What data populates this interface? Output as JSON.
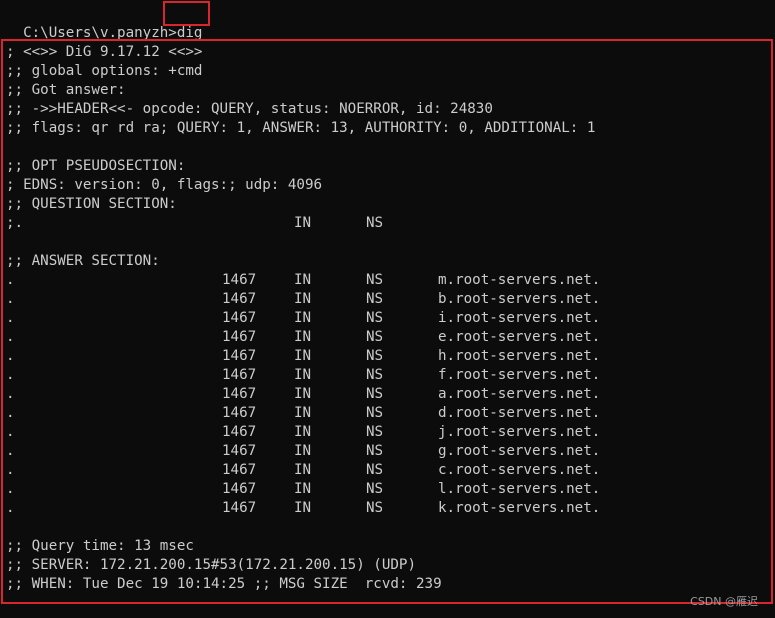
{
  "prompt": {
    "path": "C:\\Users\\v.panyzh>",
    "command": "dig"
  },
  "header_lines": [
    "; <<>> DiG 9.17.12 <<>>",
    ";; global options: +cmd",
    ";; Got answer:",
    ";; ->>HEADER<<- opcode: QUERY, status: NOERROR, id: 24830",
    ";; flags: qr rd ra; QUERY: 1, ANSWER: 13, AUTHORITY: 0, ADDITIONAL: 1"
  ],
  "opt_section": {
    "title": ";; OPT PSEUDOSECTION:",
    "edns": "; EDNS: version: 0, flags:; udp: 4096"
  },
  "question_section": {
    "title": ";; QUESTION SECTION:",
    "row": {
      "name": ";.",
      "class": "IN",
      "type": "NS"
    }
  },
  "answer_section": {
    "title": ";; ANSWER SECTION:",
    "rows": [
      {
        "name": ".",
        "ttl": "1467",
        "class": "IN",
        "type": "NS",
        "value": "m.root-servers.net."
      },
      {
        "name": ".",
        "ttl": "1467",
        "class": "IN",
        "type": "NS",
        "value": "b.root-servers.net."
      },
      {
        "name": ".",
        "ttl": "1467",
        "class": "IN",
        "type": "NS",
        "value": "i.root-servers.net."
      },
      {
        "name": ".",
        "ttl": "1467",
        "class": "IN",
        "type": "NS",
        "value": "e.root-servers.net."
      },
      {
        "name": ".",
        "ttl": "1467",
        "class": "IN",
        "type": "NS",
        "value": "h.root-servers.net."
      },
      {
        "name": ".",
        "ttl": "1467",
        "class": "IN",
        "type": "NS",
        "value": "f.root-servers.net."
      },
      {
        "name": ".",
        "ttl": "1467",
        "class": "IN",
        "type": "NS",
        "value": "a.root-servers.net."
      },
      {
        "name": ".",
        "ttl": "1467",
        "class": "IN",
        "type": "NS",
        "value": "d.root-servers.net."
      },
      {
        "name": ".",
        "ttl": "1467",
        "class": "IN",
        "type": "NS",
        "value": "j.root-servers.net."
      },
      {
        "name": ".",
        "ttl": "1467",
        "class": "IN",
        "type": "NS",
        "value": "g.root-servers.net."
      },
      {
        "name": ".",
        "ttl": "1467",
        "class": "IN",
        "type": "NS",
        "value": "c.root-servers.net."
      },
      {
        "name": ".",
        "ttl": "1467",
        "class": "IN",
        "type": "NS",
        "value": "l.root-servers.net."
      },
      {
        "name": ".",
        "ttl": "1467",
        "class": "IN",
        "type": "NS",
        "value": "k.root-servers.net."
      }
    ]
  },
  "footer_lines": [
    ";; Query time: 13 msec",
    ";; SERVER: 172.21.200.15#53(172.21.200.15) (UDP)",
    ";; WHEN: Tue Dec 19 10:14:25 ;; MSG SIZE  rcvd: 239"
  ],
  "watermark": "CSDN @雁迟",
  "colors": {
    "background": "#0c0c0c",
    "text": "#cccccc",
    "highlight_border": "#d9262c"
  }
}
